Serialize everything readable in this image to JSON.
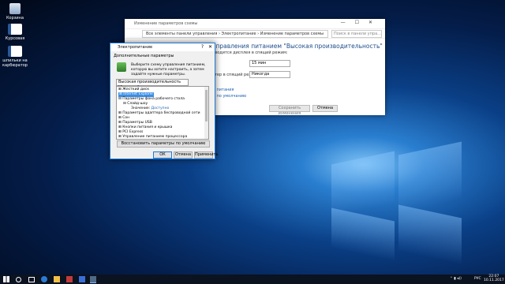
{
  "desktop": {
    "icons": [
      {
        "label": "Корзина"
      },
      {
        "label": "Курсовая"
      },
      {
        "label": "шпильки на карбюратор"
      }
    ]
  },
  "back_window": {
    "title": "Изменение параметров схемы",
    "breadcrumb": "Все элементы панели управления  ›  Электропитание  ›  Изменение параметров схемы",
    "search_placeholder": "Поиск в панели упра...",
    "heading": "управления питанием \"Высокая производительность\"",
    "subheading": "иводится дисплея в спящий режим:",
    "row1_label": "",
    "row1_value": "15 мин",
    "row2_label": "ьтер в спящий режим:",
    "row2_value": "Никогда",
    "link1": "ы питания",
    "link2": "ы по умолчанию",
    "save_button": "Сохранить изменения",
    "cancel_button": "Отмена"
  },
  "dialog": {
    "title": "Электропитание",
    "help": "?",
    "close": "✕",
    "tab": "Дополнительные параметры",
    "intro": "Выберите схему управления питанием, которую вы хотите настроить, а затем задайте нужные параметры.",
    "plan": "Высокая производительность [Активен]",
    "tree": [
      {
        "text": "⊞  Жесткий диск"
      },
      {
        "text": "⊞  Internet Explorer"
      },
      {
        "text": "⊟  Параметры фона рабочего стола"
      },
      {
        "text": "⊟  Слайд-шоу"
      },
      {
        "text": "Значение:",
        "value": "Доступно"
      },
      {
        "text": "⊞  Параметры адаптера беспроводной сети"
      },
      {
        "text": "⊞  Сон"
      },
      {
        "text": "⊞  Параметры USB"
      },
      {
        "text": "⊞  Кнопки питания и крышка"
      },
      {
        "text": "⊞  PCI Express"
      },
      {
        "text": "⊞  Управление питанием процессора"
      }
    ],
    "restore_button": "Восстановить параметры по умолчанию",
    "ok_button": "ОК",
    "cancel_button": "Отмена",
    "apply_button": "Применить"
  },
  "taskbar": {
    "lang": "РУС",
    "time": "22:07",
    "date": "10.11.2017"
  }
}
